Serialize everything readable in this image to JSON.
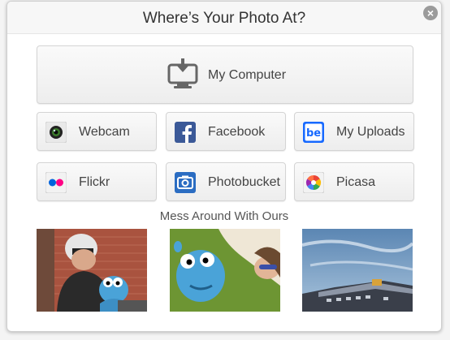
{
  "dialog": {
    "title": "Where’s Your Photo At?",
    "close_icon": "×"
  },
  "sources": {
    "my_computer": "My Computer",
    "webcam": "Webcam",
    "facebook": "Facebook",
    "my_uploads": "My Uploads",
    "flickr": "Flickr",
    "photobucket": "Photobucket",
    "picasa": "Picasa"
  },
  "samples": {
    "title": "Mess Around With Ours"
  },
  "icons": {
    "my_computer": "computer-upload-icon",
    "webcam": "webcam-icon",
    "facebook": "facebook-icon",
    "my_uploads": "behance-icon",
    "flickr": "flickr-icon",
    "photobucket": "photobucket-icon",
    "picasa": "picasa-icon"
  },
  "colors": {
    "facebook": "#3b5998",
    "behance": "#1769ff",
    "flickr_pink": "#ff0084",
    "flickr_blue": "#0063dc",
    "photobucket": "#2b6dc2"
  }
}
